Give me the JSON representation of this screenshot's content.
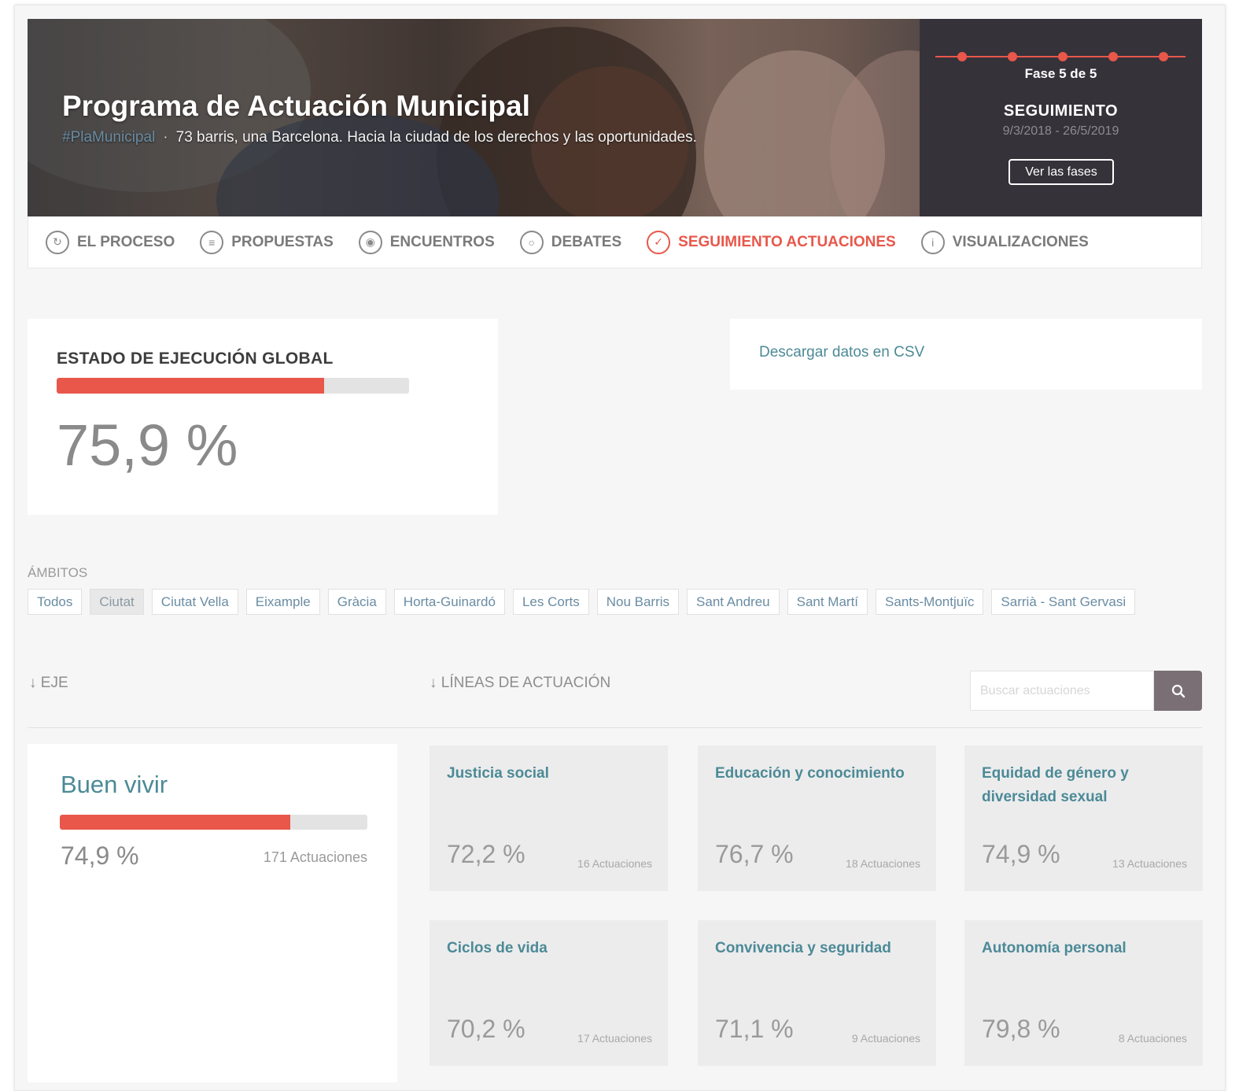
{
  "hero": {
    "title": "Programa de Actuación Municipal",
    "hashtag": "#PlaMunicipal",
    "separator": "·",
    "subtitle": "73 barris, una Barcelona. Hacia la ciudad de los derechos y las oportunidades."
  },
  "phase": {
    "number": "Fase 5 de 5",
    "name": "SEGUIMIENTO",
    "dates": "9/3/2018 - 26/5/2019",
    "button": "Ver las fases",
    "steps": 5,
    "accent": "#e8574a"
  },
  "tabs": [
    {
      "label": "EL PROCESO",
      "icon": "process-icon",
      "active": false
    },
    {
      "label": "PROPUESTAS",
      "icon": "proposals-icon",
      "active": false
    },
    {
      "label": "ENCUENTROS",
      "icon": "location-pin-icon",
      "active": false
    },
    {
      "label": "DEBATES",
      "icon": "debate-bubble-icon",
      "active": false
    },
    {
      "label": "SEGUIMIENTO ACTUACIONES",
      "icon": "checkmark-icon",
      "active": true
    },
    {
      "label": "VISUALIZACIONES",
      "icon": "info-icon",
      "active": false
    }
  ],
  "global_status": {
    "title": "ESTADO DE EJECUCIÓN GLOBAL",
    "value": "75,9 %",
    "progress": 0.759
  },
  "csv": {
    "label": "Descargar datos en CSV"
  },
  "ambitos": {
    "label": "ÁMBITOS",
    "filters": [
      "Todos",
      "Ciutat",
      "Ciutat Vella",
      "Eixample",
      "Gràcia",
      "Horta-Guinardó",
      "Les Corts",
      "Nou Barris",
      "Sant Andreu",
      "Sant Martí",
      "Sants-Montjuïc",
      "Sarrià - Sant Gervasi"
    ],
    "selected": "Ciutat"
  },
  "sort": {
    "eje": "EJE",
    "lineas": "LÍNEAS DE ACTUACIÓN",
    "arrow": "↓"
  },
  "search": {
    "placeholder": "Buscar actuaciones",
    "icon": "search-icon"
  },
  "axis": {
    "name": "Buen vivir",
    "value": "74,9 %",
    "progress": 0.749,
    "count": "171 Actuaciones"
  },
  "lines": [
    {
      "title": "Justicia social",
      "value": "72,2 %",
      "count": "16 Actuaciones"
    },
    {
      "title": "Educación y conocimiento",
      "value": "76,7 %",
      "count": "18 Actuaciones"
    },
    {
      "title": "Equidad de género y diversidad sexual",
      "value": "74,9 %",
      "count": "13 Actuaciones"
    },
    {
      "title": "Ciclos de vida",
      "value": "70,2 %",
      "count": "17 Actuaciones"
    },
    {
      "title": "Convivencia y seguridad",
      "value": "71,1 %",
      "count": "9 Actuaciones"
    },
    {
      "title": "Autonomía personal",
      "value": "79,8 %",
      "count": "8 Actuaciones"
    }
  ],
  "colors": {
    "accent": "#e8574a",
    "link": "#4c8a96",
    "muted": "#8a8a8a"
  }
}
